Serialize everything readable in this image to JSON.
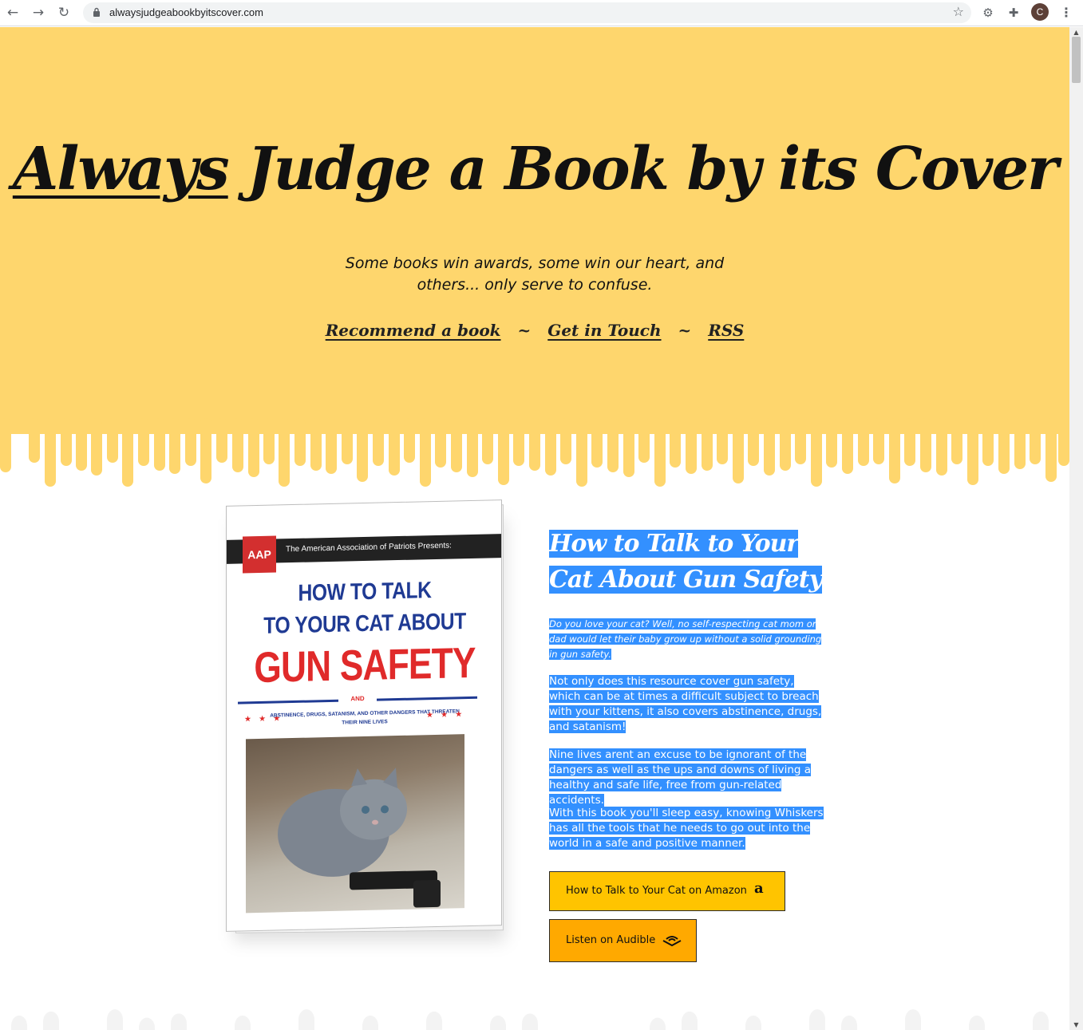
{
  "browser": {
    "url": "alwaysjudgeabookbyitscover.com",
    "profile_initial": "C"
  },
  "header": {
    "title_word1": "Always",
    "title_rest": "Judge a Book by its Cover",
    "tagline": "Some books win awards, some win our heart, and others... only serve to confuse.",
    "nav": [
      {
        "label": "Recommend a book"
      },
      {
        "label": "Get in Touch"
      },
      {
        "label": "RSS"
      }
    ],
    "nav_separator": "~"
  },
  "colors": {
    "hero_bg": "#fed66d",
    "selection": "#3390ff",
    "amazon_button": "#ffc400",
    "audible_button": "#ffa900"
  },
  "book": {
    "cover": {
      "publisher_logo": "AAP",
      "publisher_line": "The American Association of Patriots Presents:",
      "title_line1": "HOW TO TALK",
      "title_line2": "TO YOUR CAT ABOUT",
      "title_line3": "GUN SAFETY",
      "and_label": "AND",
      "subtitle": "ABSTINENCE, DRUGS, SATANISM, AND OTHER DANGERS THAT THREATEN THEIR NINE LIVES",
      "stars": "★ ★ ★",
      "photo": "kitten-with-handgun"
    },
    "title": "How to Talk to Your Cat About Gun Safety",
    "intro": "Do you love your cat? Well, no self-respecting cat mom or dad would let their baby grow up without a solid grounding in gun safety.",
    "paragraphs": [
      "Not only does this resource cover gun safety, which can be at times a difficult subject to breach with your kittens, it also covers abstinence, drugs, and satanism!",
      "Nine lives arent an excuse to be ignorant of the dangers as well as the ups and downs of living a healthy and safe life, free from gun-related accidents.",
      "With this book you'll sleep easy, knowing Whiskers has all the tools that he needs to go out into the world in a safe and positive manner."
    ],
    "buttons": {
      "amazon": "How to Talk to Your Cat on Amazon",
      "amazon_icon": "amazon-icon",
      "audible": "Listen on Audible",
      "audible_icon": "audible-icon"
    }
  }
}
